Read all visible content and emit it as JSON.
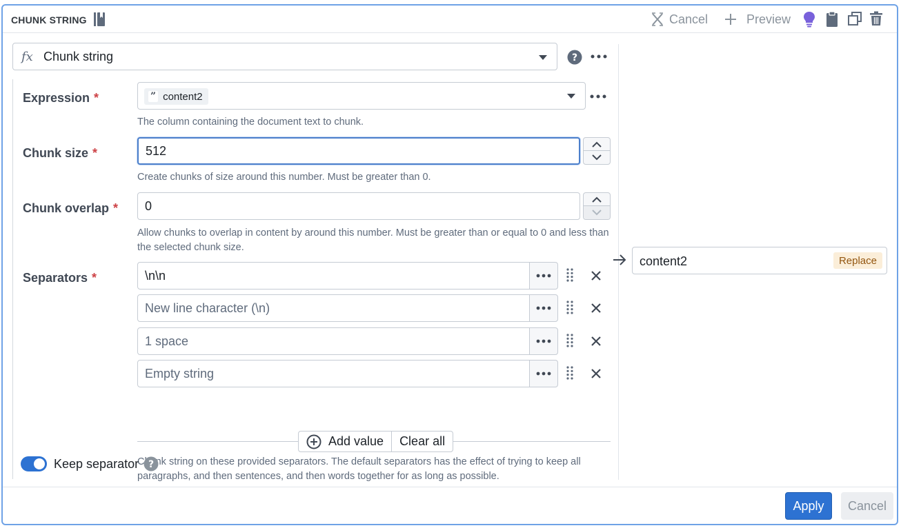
{
  "header": {
    "title": "CHUNK STRING",
    "cancel_label": "Cancel",
    "preview_label": "Preview"
  },
  "function": {
    "icon": "fx-icon",
    "icon_text": "fx",
    "name": "Chunk string"
  },
  "params": {
    "expression": {
      "label": "Expression",
      "required": "*",
      "value": "content2",
      "tag_icon": "”",
      "hint": "The column containing the document text to chunk."
    },
    "chunk_size": {
      "label": "Chunk size",
      "required": "*",
      "value": "512",
      "hint": "Create chunks of size around this number. Must be greater than 0."
    },
    "chunk_overlap": {
      "label": "Chunk overlap",
      "required": "*",
      "value": "0",
      "hint": "Allow chunks to overlap in content by around this number. Must be greater than or equal to 0 and less than the selected chunk size."
    },
    "separators": {
      "label": "Separators",
      "required": "*",
      "items": [
        {
          "value": "\\n\\n",
          "placeholder": false
        },
        {
          "value": "New line character (\\n)",
          "placeholder": true
        },
        {
          "value": "1 space",
          "placeholder": true
        },
        {
          "value": "Empty string",
          "placeholder": true
        }
      ],
      "add_label": "Add value",
      "clear_label": "Clear all",
      "hint": "Chunk string on these provided separators. The default separators has the effect of trying to keep all paragraphs, and then sentences, and then words together for as long as possible."
    },
    "keep_separator": {
      "label": "Keep separator",
      "enabled": true
    }
  },
  "output": {
    "value": "content2",
    "tag": "Replace"
  },
  "footer": {
    "apply_label": "Apply",
    "cancel_label": "Cancel"
  },
  "colors": {
    "primary": "#2d72d2",
    "required": "#cd4246",
    "hint_bulb": "#7961db",
    "replace_bg": "#fbeed9",
    "replace_text": "#935610"
  }
}
